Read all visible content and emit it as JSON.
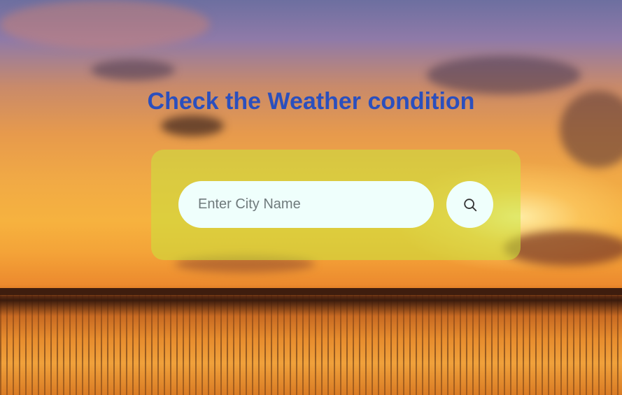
{
  "page": {
    "title": "Check the Weather condition"
  },
  "search": {
    "placeholder": "Enter City Name",
    "value": "",
    "button_icon": "search-icon"
  },
  "colors": {
    "title": "#2b4fbd",
    "card_background": "rgba(200, 230, 60, 0.55)",
    "input_background": "#effffc"
  }
}
